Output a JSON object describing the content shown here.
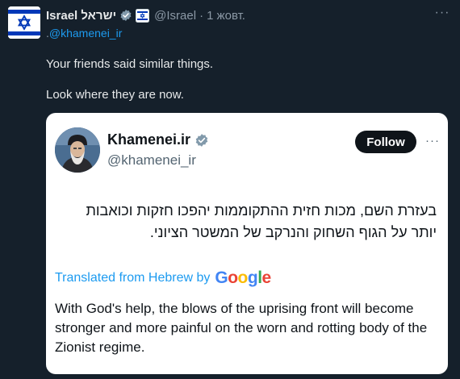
{
  "post": {
    "display_name": "Israel ישראל",
    "handle": "@Israel",
    "date": "1 жовт.",
    "separator": "·",
    "more": "···",
    "reply_prefix": ".",
    "reply_mention": "@khamenei_ir",
    "text_lines": [
      "Your friends said similar things.",
      "Look where they are now."
    ]
  },
  "quote": {
    "name": "Khamenei.ir",
    "handle": "@khamenei_ir",
    "follow_label": "Follow",
    "more": "···",
    "hebrew_text": "בעזרת השם, מכות חזית ההתקוממות יהפכו חזקות וכואבות יותר על הגוף השחוק והנרקב של המשטר הציוני.",
    "translated_label": "Translated from Hebrew by",
    "translator": "Google",
    "english_text": "With God's help, the blows of the uprising front will become stronger and more painful on the worn and rotting body of the Zionist regime."
  },
  "colors": {
    "background": "#15202b",
    "link_blue": "#1d9bf0",
    "verified_gold": "#e2b719",
    "follow_bg": "#0f1419"
  },
  "icons": [
    "israel-flag-avatar-icon",
    "verified-check-icon",
    "org-badge-icon",
    "more-options-icon",
    "profile-avatar"
  ]
}
